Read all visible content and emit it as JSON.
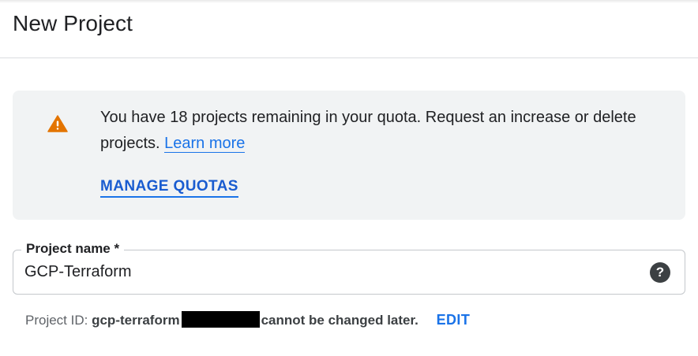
{
  "dialog": {
    "title": "New Project"
  },
  "quota_notice": {
    "icon": "warning-icon",
    "icon_color": "#e37400",
    "message": "You have 18 projects remaining in your quota. Request an increase or delete projects.",
    "learn_more_label": "Learn more",
    "manage_quotas_label": "MANAGE QUOTAS"
  },
  "project_name_field": {
    "label": "Project name *",
    "value": "GCP-Terraform",
    "help_icon": "help-icon"
  },
  "project_id": {
    "label": "Project ID:",
    "value": "gcp-terraform",
    "suffix": "cannot be changed later.",
    "edit_label": "EDIT"
  },
  "colors": {
    "accent": "#1a73e8",
    "notice_background": "#f1f3f4",
    "warning": "#e37400"
  }
}
